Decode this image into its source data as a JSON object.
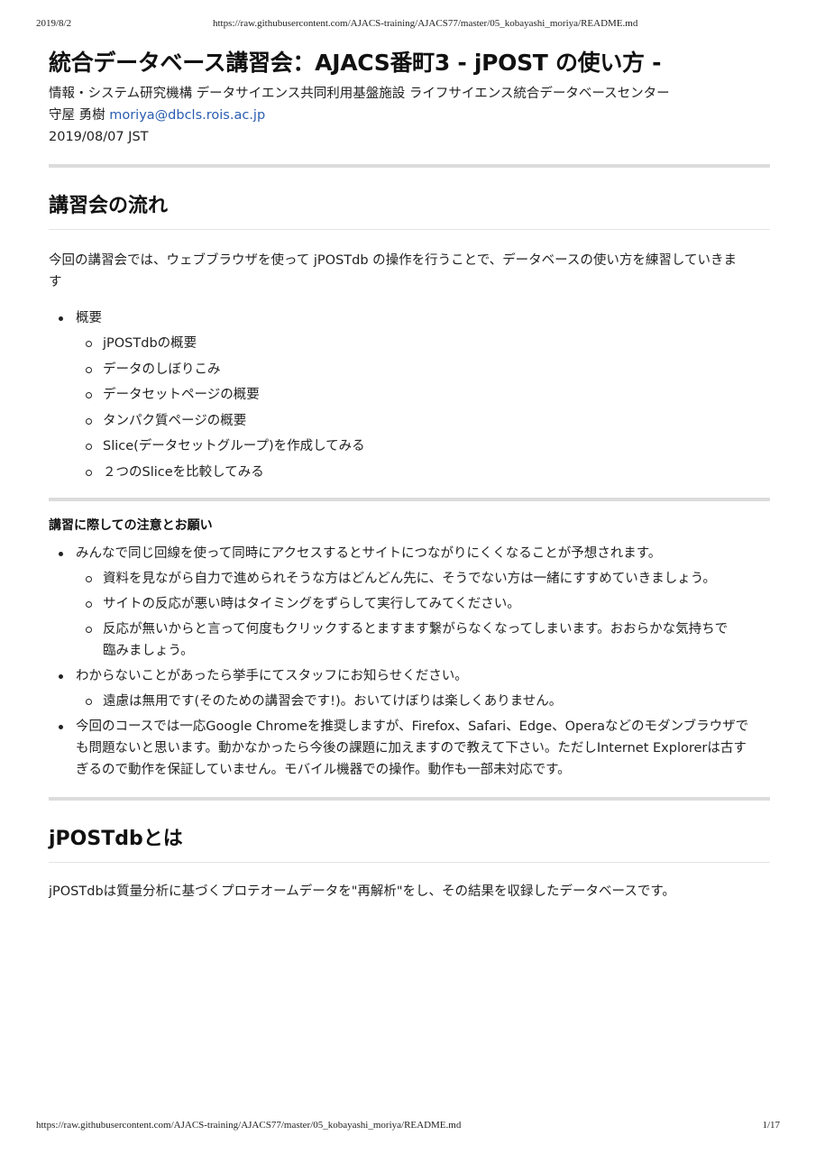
{
  "print_header": {
    "date": "2019/8/2",
    "url": "https://raw.githubusercontent.com/AJACS-training/AJACS77/master/05_kobayashi_moriya/README.md"
  },
  "print_footer": {
    "url": "https://raw.githubusercontent.com/AJACS-training/AJACS77/master/05_kobayashi_moriya/README.md",
    "page": "1/17"
  },
  "document": {
    "title": "統合データベース講習会：AJACS番町3 - jPOST の使い方 -",
    "affiliation": "情報・システム研究機構 データサイエンス共同利用基盤施設 ライフサイエンス統合データベースセンター",
    "author_name": "守屋 勇樹",
    "author_email": "moriya@dbcls.rois.ac.jp",
    "date": "2019/08/07 JST"
  },
  "section_flow": {
    "heading": "講習会の流れ",
    "intro_line1": "今回の講習会では、ウェブブラウザを使って jPOSTdb の操作を行うことで、データベースの使い方を練習していきま",
    "intro_line2": "す",
    "outline": {
      "label": "概要",
      "items": [
        "jPOSTdbの概要",
        "データのしぼりこみ",
        "データセットページの概要",
        "タンパク質ページの概要",
        "Slice(データセットグループ)を作成してみる",
        "２つのSliceを比較してみる"
      ]
    }
  },
  "section_notes": {
    "heading": "講習に際しての注意とお願い",
    "items": [
      {
        "text": "みんなで同じ回線を使って同時にアクセスするとサイトにつながりにくくなることが予想されます。",
        "sub": [
          {
            "lines": [
              "資料を見ながら自力で進められそうな方はどんどん先に、そうでない方は一緒にすすめていきましょう。"
            ]
          },
          {
            "lines": [
              "サイトの反応が悪い時はタイミングをずらして実行してみてください。"
            ]
          },
          {
            "lines": [
              "反応が無いからと言って何度もクリックするとますます繋がらなくなってしまいます。おおらかな気持ちで",
              "臨みましょう。"
            ]
          }
        ]
      },
      {
        "text": "わからないことがあったら挙手にてスタッフにお知らせください。",
        "sub": [
          {
            "lines": [
              "遠慮は無用です(そのための講習会です!)。おいてけぼりは楽しくありません。"
            ]
          }
        ]
      },
      {
        "lines": [
          "今回のコースでは一応Google Chromeを推奨しますが、Firefox、Safari、Edge、Operaなどのモダンブラウザで",
          "も問題ないと思います。動かなかったら今後の課題に加えますので教えて下さい。ただしInternet Explorerは古す",
          "ぎるので動作を保証していません。モバイル機器での操作。動作も一部未対応です。"
        ]
      }
    ]
  },
  "section_about": {
    "heading": "jPOSTdbとは",
    "text": "jPOSTdbは質量分析に基づくプロテオームデータを\"再解析\"をし、その結果を収録したデータベースです。"
  }
}
